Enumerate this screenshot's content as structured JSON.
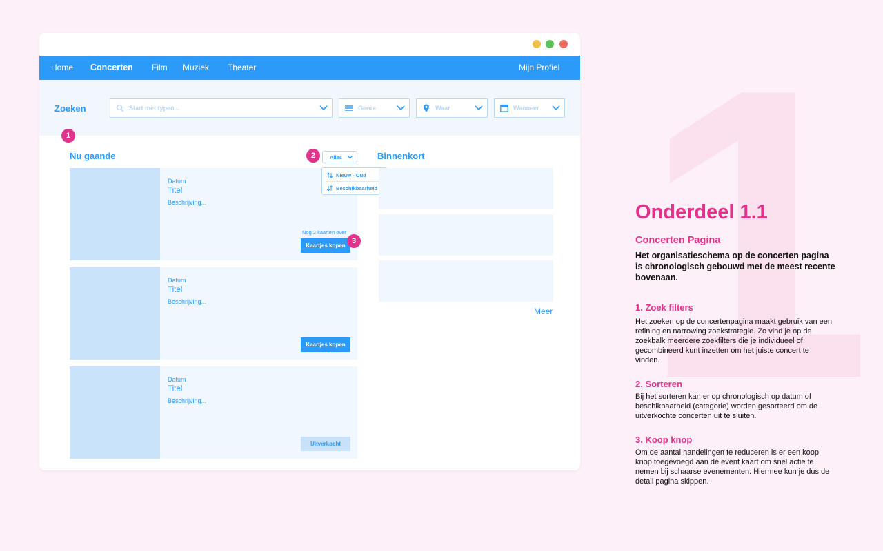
{
  "decor": {
    "big_number": "1"
  },
  "nav": {
    "items": [
      {
        "label": "Home"
      },
      {
        "label": "Concerten"
      },
      {
        "label": "Film"
      },
      {
        "label": "Muziek"
      },
      {
        "label": "Theater"
      }
    ],
    "profile": "Mijn Profiel"
  },
  "search": {
    "label": "Zoeken",
    "query_placeholder": "Start met typen...",
    "genre": "Genre",
    "where": "Waar",
    "when": "Wanneer"
  },
  "badges": [
    "1",
    "2",
    "3"
  ],
  "current": {
    "title": "Nu gaande",
    "sort": {
      "selected": "Alles",
      "options": [
        "Nieuw - Oud",
        "Beschikbaarheid"
      ]
    },
    "cards": [
      {
        "date": "Datum",
        "title": "Titel",
        "desc": "Beschrijving...",
        "remaining": "Nog 2 kaarten over",
        "button": "Kaartjes kopen"
      },
      {
        "date": "Datum",
        "title": "Titel",
        "desc": "Beschrijving...",
        "button": "Kaartjes kopen"
      },
      {
        "date": "Datum",
        "title": "Titel",
        "desc": "Beschrijving...",
        "button": "Uitverkocht"
      }
    ]
  },
  "upcoming": {
    "title": "Binnenkort",
    "more": "Meer"
  },
  "panel": {
    "title": "Onderdeel 1.1",
    "subtitle": "Concerten Pagina",
    "lead": "Het organisatieschema op de concerten pagina is chronologisch gebouwd met de meest recente bovenaan.",
    "sections": [
      {
        "heading": "1. Zoek filters",
        "body": "Het zoeken op de concertenpagina maakt gebruik van een refining en narrowing zoekstrategie. Zo vind je op de zoekbalk meerdere zoekfilters die je individueel of gecombineerd kunt inzetten om het juiste concert te vinden."
      },
      {
        "heading": "2. Sorteren",
        "body": "Bij het sorteren kan er op chronologisch op datum of beschikbaarheid (categorie) worden gesorteerd om de uitverkochte concerten uit te sluiten."
      },
      {
        "heading": "3. Koop knop",
        "body": "Om de aantal handelingen te reduceren is er een koop knop toegevoegd aan de event kaart om snel actie te nemen bij schaarse evenementen. Hiermee kun je dus de detail pagina skippen."
      }
    ]
  },
  "colors": {
    "accent": "#2b9af8",
    "brand": "#e2338c",
    "background": "#fdf0f8"
  }
}
